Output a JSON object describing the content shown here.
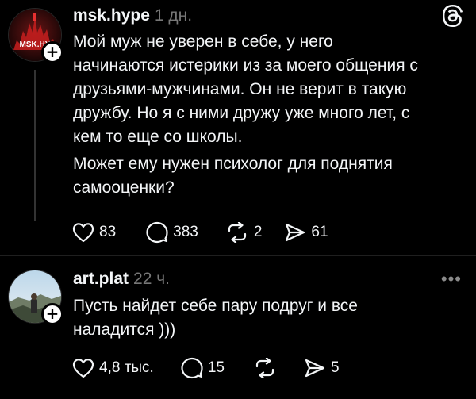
{
  "post": {
    "username": "msk.hype",
    "time": "1 дн.",
    "avatar_text": "MSK.HY",
    "paragraphs": [
      "Мой муж не уверен в себе, у него начинаются истерики из за моего общения с друзьями-мужчинами.  Он не верит в такую дружбу. Но я с ними дружу уже много лет, с кем то еще со школы.",
      "Может ему нужен психолог для поднятия самооценки?"
    ],
    "likes": "83",
    "comments": "383",
    "reposts": "2",
    "shares": "61"
  },
  "reply": {
    "username": "art.plat",
    "time": "22 ч.",
    "text": "Пусть найдет себе пару подруг и все наладится )))",
    "likes": "4,8 тыс.",
    "comments": "15",
    "reposts": "",
    "shares": "5"
  },
  "icons": [
    "threads-logo-icon",
    "heart-icon",
    "comment-icon",
    "repost-icon",
    "share-icon",
    "more-icon",
    "plus-icon"
  ]
}
